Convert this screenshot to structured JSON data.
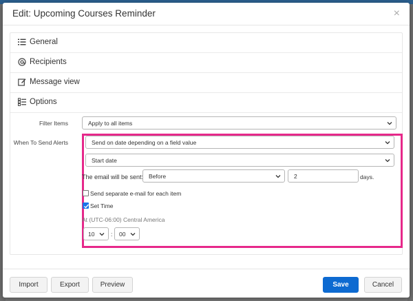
{
  "dialog": {
    "title": "Edit: Upcoming Courses Reminder",
    "close_label": "×"
  },
  "sections": [
    {
      "label": "General",
      "icon": "list-icon"
    },
    {
      "label": "Recipients",
      "icon": "at-icon"
    },
    {
      "label": "Message view",
      "icon": "edit-icon"
    },
    {
      "label": "Options",
      "icon": "checklist-icon"
    }
  ],
  "options": {
    "filter_items_label": "Filter Items",
    "filter_items_value": "Apply to all items",
    "when_to_send_label": "When To Send Alerts",
    "when_to_send_value": "Send on date depending on a field value",
    "date_field_value": "Start date",
    "email_sent_label": "The email will be sent:",
    "email_sent_value": "Before",
    "days_value": "2",
    "days_label": "days.",
    "separate_email_label": "Send separate e-mail for each item",
    "separate_email_checked": false,
    "set_time_label": "Set Time",
    "set_time_checked": true,
    "timezone_text": "At (UTC-06:00) Central America",
    "hour_value": "10",
    "time_separator": ":",
    "minute_value": "00"
  },
  "footer": {
    "import_label": "Import",
    "export_label": "Export",
    "preview_label": "Preview",
    "save_label": "Save",
    "cancel_label": "Cancel"
  },
  "colors": {
    "highlight": "#e6288a",
    "primary": "#0d6ad1"
  }
}
